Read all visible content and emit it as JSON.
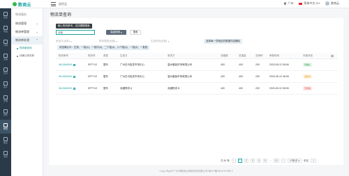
{
  "app": {
    "logo_text": "数商云",
    "breadcrumb": "退货品"
  },
  "topbar": {
    "location": "广州",
    "region": "简体中文-ZH",
    "user": "数商云"
  },
  "submenu": {
    "title": "物流服务",
    "groups": [
      {
        "label": "物流管理",
        "open": false
      },
      {
        "label": "物流单管理",
        "open": false
      },
      {
        "label": "物流单处理",
        "open": true
      }
    ],
    "items": [
      {
        "label": "物流单查询",
        "active": true
      },
      {
        "label": "待确认物流单",
        "active": false
      }
    ]
  },
  "rail": {
    "items": [
      {
        "label": "首页",
        "icon": "home-icon"
      },
      {
        "label": "商品",
        "icon": "goods-icon"
      },
      {
        "label": "订单",
        "icon": "order-icon"
      },
      {
        "label": "营销",
        "icon": "marketing-icon"
      },
      {
        "label": "会员",
        "icon": "member-icon"
      },
      {
        "label": "客户",
        "icon": "customer-icon"
      },
      {
        "label": "仓储",
        "icon": "warehouse-icon"
      },
      {
        "label": "财务",
        "icon": "finance-icon"
      },
      {
        "label": "物流",
        "icon": "logistics-icon"
      },
      {
        "label": "报表",
        "icon": "report-icon"
      },
      {
        "label": "设置",
        "icon": "settings-icon"
      }
    ]
  },
  "page": {
    "title": "物流单查询"
  },
  "search": {
    "tooltip": "输入物流单号、支持模糊搜索",
    "placeholder": "请输",
    "advanced_label": "高级搜索",
    "search_label": "搜索"
  },
  "filters": {
    "carrier": "承运方(全部)",
    "type": "物流类型(全部)",
    "status": "生成状态(全部)",
    "hint": "选择每一项相应的数据内容删除"
  },
  "status_tooltip": "状态确认中：生效、一批(4)、一批中(4)、二个批(4)、六个批(4)、一批(4)、一批批",
  "table": {
    "columns": [
      "物流单号",
      "物流号",
      "类型",
      "生成方",
      "收货方",
      "总箱数",
      "总重量",
      "总体积",
      "审核时间",
      "外部状态"
    ],
    "rows": [
      {
        "no": "WL0564549",
        "code": "DPTY12",
        "type": "整车",
        "origin": "广州白马批发市场中心",
        "dest": "温州服装市场有限公司",
        "boxes": "400",
        "weight": "400",
        "volume": "200",
        "time": "2020-05-12 08:06",
        "status": "待确认",
        "status_color": "green"
      },
      {
        "no": "WL0564549",
        "code": "DPTY12",
        "type": "整车",
        "origin": "广州白马批发市场中心",
        "dest": "温州服装市场有限公司",
        "boxes": "400",
        "weight": "400",
        "volume": "200",
        "time": "2020-05-12 08:06",
        "status": "运输中",
        "status_color": "orange"
      },
      {
        "no": "WL0564549",
        "code": "DPTY12",
        "type": "整车",
        "origin": "深通物流 A",
        "dest": "深通物流 B",
        "boxes": "400",
        "weight": "400",
        "volume": "200",
        "time": "2020-05-12 08:06",
        "status": "已拒收",
        "status_color": "red"
      }
    ]
  },
  "pager": {
    "total": "共 80 条",
    "pages": [
      "1",
      "2",
      "3",
      "4",
      "5",
      "...",
      "10"
    ],
    "current": "1",
    "size": "10条/页",
    "goto_label": "前往",
    "goto_value": "1"
  },
  "footer": {
    "text": "Copy Right©广州市数商云网络科技有限公司 粤ICP备15047978号-3"
  },
  "colors": {
    "accent": "#1aa3a3",
    "rail_bg": "#2b3a48"
  }
}
